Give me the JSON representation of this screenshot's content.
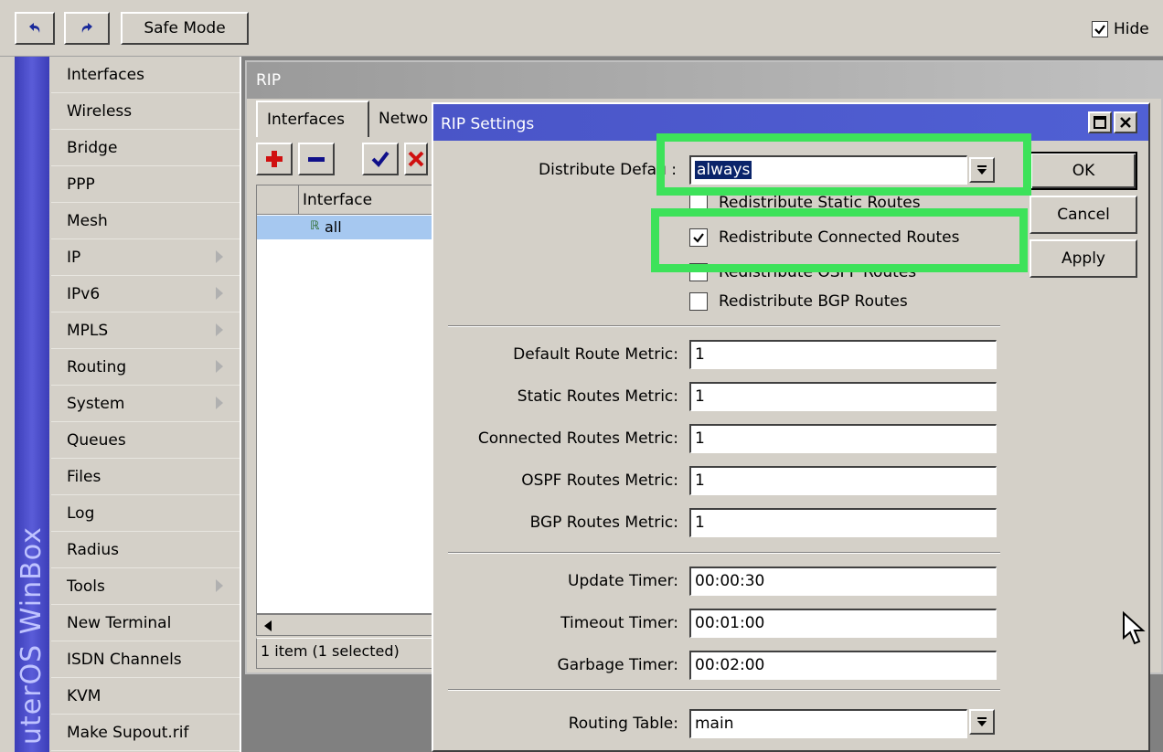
{
  "toolbar": {
    "undo_icon": "undo-icon",
    "redo_icon": "redo-icon",
    "safe_mode_label": "Safe Mode",
    "hide_label": "Hide",
    "hide_checked": true
  },
  "banner": {
    "text": "uterOS WinBox"
  },
  "sidebar": {
    "items": [
      {
        "label": "Interfaces",
        "has_submenu": false
      },
      {
        "label": "Wireless",
        "has_submenu": false
      },
      {
        "label": "Bridge",
        "has_submenu": false
      },
      {
        "label": "PPP",
        "has_submenu": false
      },
      {
        "label": "Mesh",
        "has_submenu": false
      },
      {
        "label": "IP",
        "has_submenu": true
      },
      {
        "label": "IPv6",
        "has_submenu": true
      },
      {
        "label": "MPLS",
        "has_submenu": true
      },
      {
        "label": "Routing",
        "has_submenu": true
      },
      {
        "label": "System",
        "has_submenu": true
      },
      {
        "label": "Queues",
        "has_submenu": false
      },
      {
        "label": "Files",
        "has_submenu": false
      },
      {
        "label": "Log",
        "has_submenu": false
      },
      {
        "label": "Radius",
        "has_submenu": false
      },
      {
        "label": "Tools",
        "has_submenu": true
      },
      {
        "label": "New Terminal",
        "has_submenu": false
      },
      {
        "label": "ISDN Channels",
        "has_submenu": false
      },
      {
        "label": "KVM",
        "has_submenu": false
      },
      {
        "label": "Make Supout.rif",
        "has_submenu": false
      }
    ]
  },
  "rip_window": {
    "title": "RIP",
    "tabs": [
      "Interfaces",
      "Netwo"
    ],
    "list_header": "Interface",
    "rows": [
      {
        "name": "all",
        "selected": true
      }
    ],
    "status": "1 item (1 selected)"
  },
  "dialog": {
    "title": "RIP Settings",
    "distribute_default": {
      "label": "Distribute Defau :",
      "value": "always"
    },
    "checkboxes": [
      {
        "label": "Redistribute Static Routes",
        "checked": false
      },
      {
        "label": "Redistribute Connected Routes",
        "checked": true
      },
      {
        "label": "Redistribute OSPF Routes",
        "checked": false
      },
      {
        "label": "Redistribute BGP Routes",
        "checked": false
      }
    ],
    "metrics": [
      {
        "label": "Default Route Metric:",
        "value": "1"
      },
      {
        "label": "Static Routes Metric:",
        "value": "1"
      },
      {
        "label": "Connected Routes Metric:",
        "value": "1"
      },
      {
        "label": "OSPF Routes Metric:",
        "value": "1"
      },
      {
        "label": "BGP Routes Metric:",
        "value": "1"
      }
    ],
    "timers": [
      {
        "label": "Update Timer:",
        "value": "00:00:30"
      },
      {
        "label": "Timeout Timer:",
        "value": "00:01:00"
      },
      {
        "label": "Garbage Timer:",
        "value": "00:02:00"
      }
    ],
    "routing_table": {
      "label": "Routing Table:",
      "value": "main"
    },
    "buttons": {
      "ok": "OK",
      "cancel": "Cancel",
      "apply": "Apply"
    }
  },
  "colors": {
    "highlight": "#3de25a",
    "title_bar": "#4a55c8",
    "selection": "#0a246a"
  }
}
